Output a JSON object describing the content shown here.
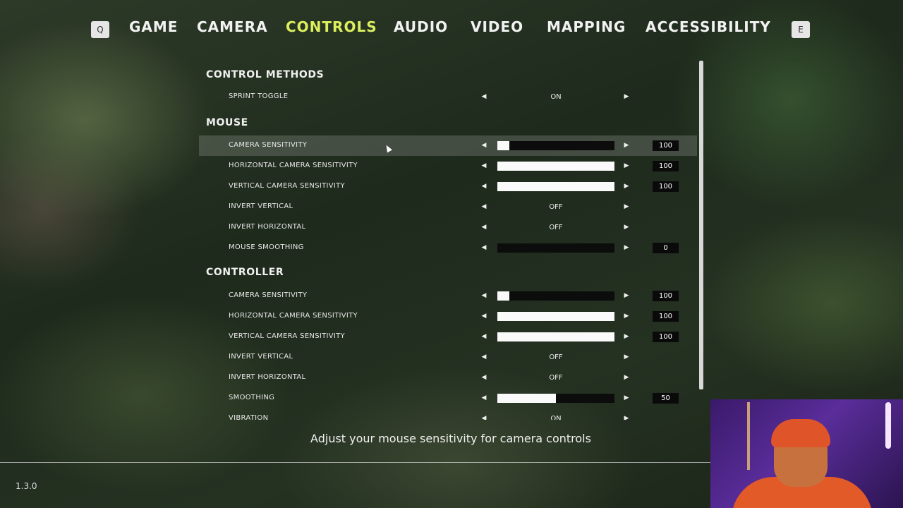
{
  "nav": {
    "left_key": "Q",
    "right_key": "E",
    "tabs": [
      {
        "label": "GAME"
      },
      {
        "label": "CAMERA"
      },
      {
        "label": "CONTROLS",
        "active": true
      },
      {
        "label": "AUDIO"
      },
      {
        "label": "VIDEO"
      },
      {
        "label": "MAPPING"
      },
      {
        "label": "ACCESSIBILITY"
      }
    ],
    "active_color": "#dcef5e"
  },
  "sections": {
    "control_methods": {
      "title": "CONTROL METHODS",
      "rows": [
        {
          "label": "SPRINT TOGGLE",
          "value": "ON"
        }
      ]
    },
    "mouse": {
      "title": "MOUSE",
      "rows": [
        {
          "label": "CAMERA SENSITIVITY",
          "number": "100",
          "fill": 0.1
        },
        {
          "label": "HORIZONTAL CAMERA SENSITIVITY",
          "number": "100",
          "fill": 1.0
        },
        {
          "label": "VERTICAL CAMERA SENSITIVITY",
          "number": "100",
          "fill": 1.0
        },
        {
          "label": "INVERT VERTICAL",
          "value": "OFF"
        },
        {
          "label": "INVERT HORIZONTAL",
          "value": "OFF"
        },
        {
          "label": "MOUSE SMOOTHING",
          "number": "0",
          "fill": 0.0
        }
      ]
    },
    "controller": {
      "title": "CONTROLLER",
      "rows": [
        {
          "label": "CAMERA SENSITIVITY",
          "number": "100",
          "fill": 0.1
        },
        {
          "label": "HORIZONTAL CAMERA SENSITIVITY",
          "number": "100",
          "fill": 1.0
        },
        {
          "label": "VERTICAL CAMERA SENSITIVITY",
          "number": "100",
          "fill": 1.0
        },
        {
          "label": "INVERT VERTICAL",
          "value": "OFF"
        },
        {
          "label": "INVERT HORIZONTAL",
          "value": "OFF"
        },
        {
          "label": "SMOOTHING",
          "number": "50",
          "fill": 0.5
        },
        {
          "label": "VIBRATION",
          "value": "ON"
        }
      ]
    }
  },
  "description": "Adjust your mouse sensitivity for camera controls",
  "version": "1.3.0"
}
